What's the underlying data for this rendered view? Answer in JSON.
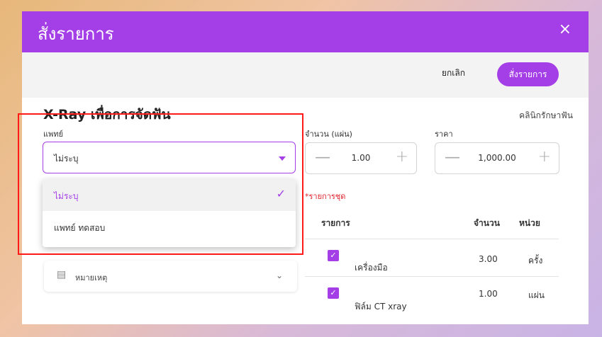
{
  "modal": {
    "title": "สั่งรายการ",
    "close_icon": "×"
  },
  "toolbar": {
    "cancel_label": "ยกเลิก",
    "order_label": "สั่งรายการ"
  },
  "form": {
    "heading": "X-Ray เพื่อการจัดฟัน",
    "clinic_label": "คลินิกรักษาฟัน",
    "doctor_label": "แพทย์",
    "doctor_value": "ไม่ระบุ",
    "doctor_options": [
      {
        "label": "ไม่ระบุ",
        "selected": true
      },
      {
        "label": "แพทย์ ทดสอบ",
        "selected": false
      }
    ],
    "quantity_label": "จำนวน (แผ่น)",
    "quantity_value": "1.00",
    "price_label": "ราคา",
    "price_value": "1,000.00",
    "set_items_label": "*รายการชุด",
    "note_label": "หมายเหตุ"
  },
  "table": {
    "headers": [
      "รายการ",
      "จำนวน",
      "หน่วย"
    ],
    "rows": [
      {
        "checked": true,
        "name": "เครื่องมือ",
        "qty": "3.00",
        "unit": "ครั้ง"
      },
      {
        "checked": true,
        "name": "ฟิล์ม CT xray",
        "qty": "1.00",
        "unit": "แผ่น"
      }
    ]
  },
  "icons": {
    "minus": "—",
    "plus": "+",
    "check": "✓",
    "chevron": "⌄",
    "note": "▤"
  },
  "colors": {
    "accent": "#a43ee6",
    "highlight_box": "#ff1a1a",
    "required": "#e2222c"
  }
}
